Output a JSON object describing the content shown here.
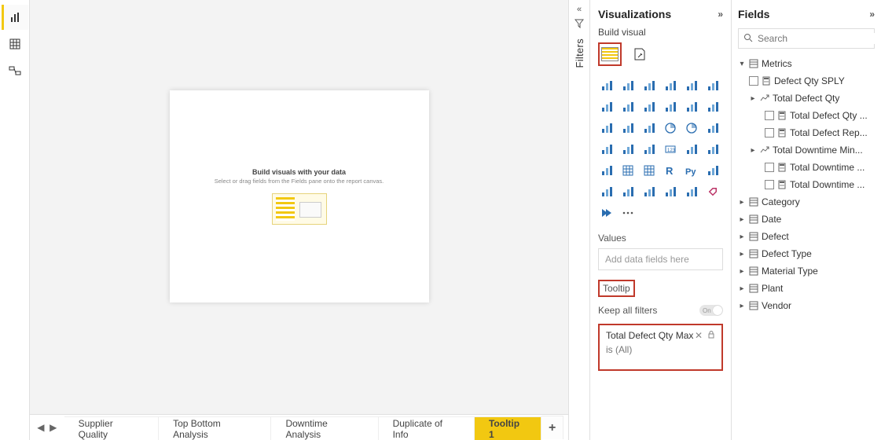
{
  "leftRail": {
    "items": [
      "report",
      "data",
      "model"
    ]
  },
  "canvas": {
    "title": "Build visuals with your data",
    "sub": "Select or drag fields from the Fields pane onto the report canvas."
  },
  "tabs": {
    "items": [
      "Supplier Quality",
      "Top Bottom Analysis",
      "Downtime Analysis",
      "Duplicate of Info",
      "Tooltip 1"
    ],
    "activeIndex": 4
  },
  "filtersPane": {
    "label": "Filters"
  },
  "vizPane": {
    "title": "Visualizations",
    "sub": "Build visual",
    "valuesLabel": "Values",
    "valuesPlaceholder": "Add data fields here",
    "tooltipLabel": "Tooltip",
    "keepLabel": "Keep all filters",
    "toggleText": "On",
    "filterCard": {
      "title": "Total Defect Qty Max",
      "sub": "is (All)"
    }
  },
  "fieldsPane": {
    "title": "Fields",
    "searchPlaceholder": "Search",
    "metricsLabel": "Metrics",
    "metrics": [
      "Defect Qty SPLY",
      "Total Defect Qty",
      "Total Defect Qty ...",
      "Total Defect Rep...",
      "Total Downtime Min...",
      "Total Downtime ...",
      "Total Downtime ..."
    ],
    "tables": [
      "Category",
      "Date",
      "Defect",
      "Defect Type",
      "Material Type",
      "Plant",
      "Vendor"
    ]
  }
}
